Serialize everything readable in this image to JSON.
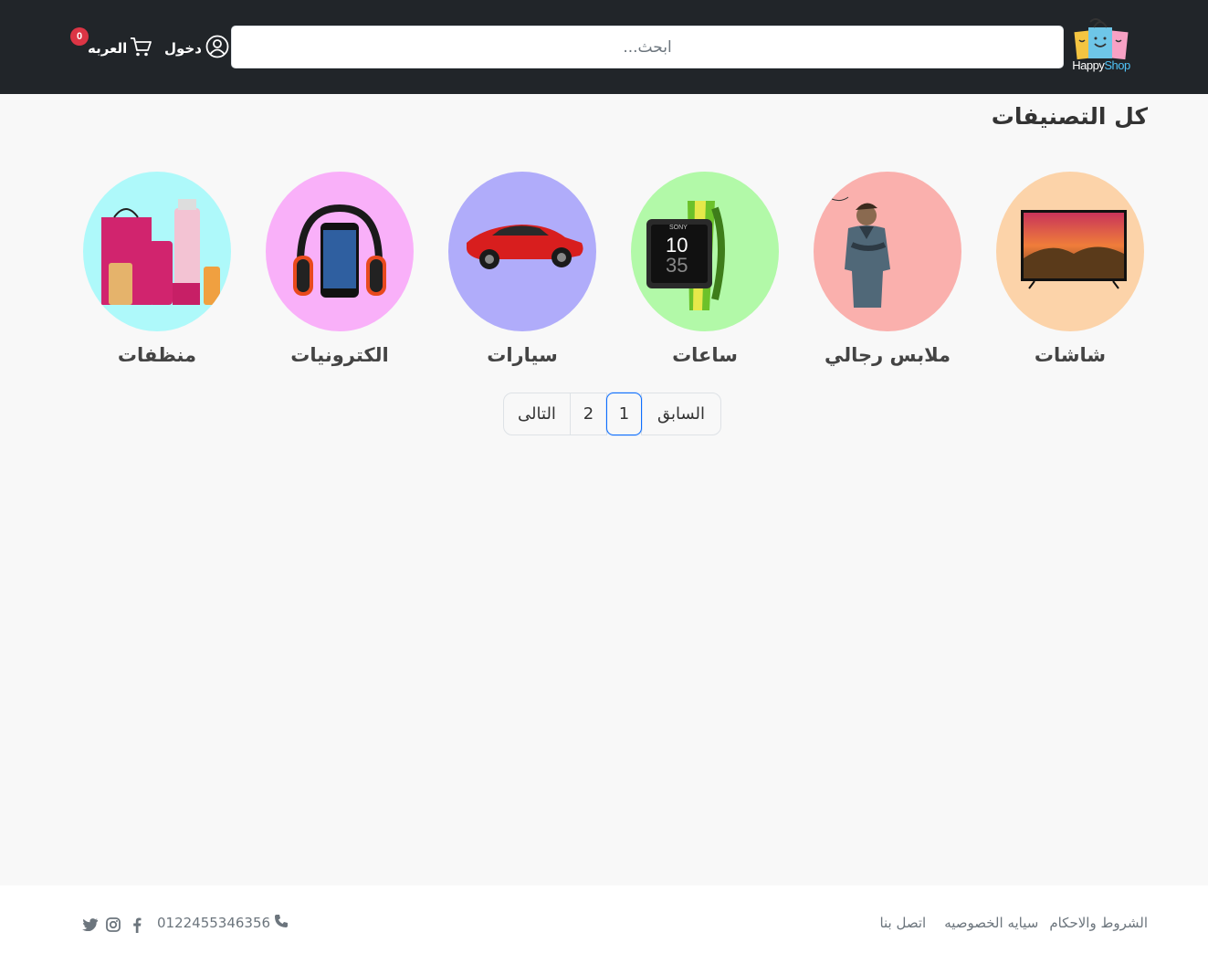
{
  "header": {
    "logo_text_1": "Happy",
    "logo_text_2": "Shop",
    "search_placeholder": "ابحث...",
    "login_label": "دخول",
    "cart_label": "العربه",
    "cart_count": "0"
  },
  "main": {
    "title": "كل التصنيفات",
    "categories": [
      {
        "label": "شاشات",
        "bg": "#fcd3a9"
      },
      {
        "label": "ملابس رجالي",
        "bg": "#fab0ad"
      },
      {
        "label": "ساعات",
        "bg": "#b2f9a8"
      },
      {
        "label": "سيارات",
        "bg": "#b0acfa"
      },
      {
        "label": "الكترونيات",
        "bg": "#f9b0f9"
      },
      {
        "label": "منظفات",
        "bg": "#aef9fa"
      }
    ],
    "watch_time_h": "10",
    "watch_time_m": "35",
    "watch_brand": "SONY",
    "pagination": {
      "prev": "السابق",
      "page1": "1",
      "page2": "2",
      "next": "التالى"
    }
  },
  "footer": {
    "links": [
      "الشروط والاحكام",
      "سيايه الخصوصيه",
      "اتصل بنا"
    ],
    "phone": "0122455346356"
  },
  "colors": {
    "header_bg": "#212529",
    "page_bg": "#f8f8f8",
    "active_page_border": "#0d6efd",
    "badge": "#dc3545"
  }
}
